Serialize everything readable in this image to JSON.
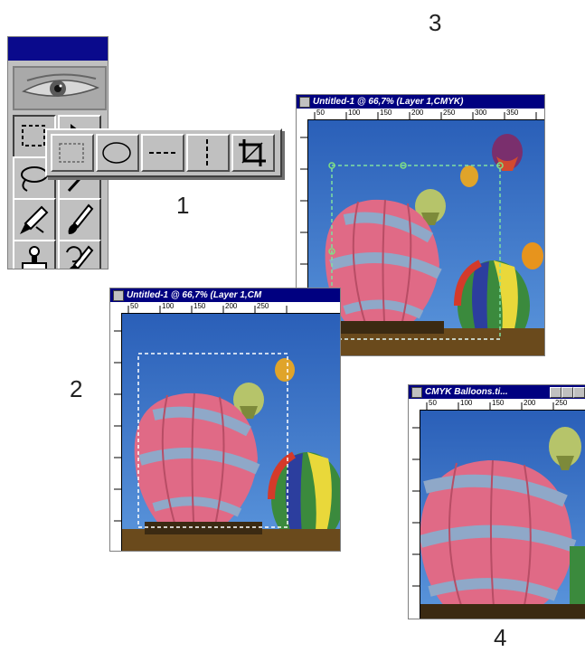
{
  "labels": {
    "one": "1",
    "two": "2",
    "three": "3",
    "four": "4"
  },
  "windows": {
    "win1_title": "Untitled-1 @ 66,7% (Layer 1,CMYK)",
    "win2_title": "Untitled-1 @ 66,7% (Layer 1,CM",
    "win3_title": "CMYK Balloons.ti..."
  },
  "ruler_marks": {
    "win1": [
      "50",
      "100",
      "150",
      "200",
      "250",
      "300",
      "350"
    ],
    "win2": [
      "50",
      "100",
      "150",
      "200",
      "250"
    ],
    "win3": [
      "50",
      "100",
      "150",
      "200",
      "250"
    ]
  },
  "toolbox": {
    "tools": [
      "marquee-tool",
      "move-tool",
      "lasso-tool",
      "magic-wand-tool",
      "airbrush-tool",
      "paintbrush-tool",
      "rubber-stamp-tool",
      "history-brush-tool"
    ],
    "flyout_tools": [
      "rectangular-marquee",
      "elliptical-marquee",
      "single-row-marquee",
      "single-column-marquee",
      "crop-tool"
    ]
  },
  "colors": {
    "title_bar": "#000080",
    "toolbox_title": "#0a0a8c",
    "sky": "#2f6fc4"
  }
}
